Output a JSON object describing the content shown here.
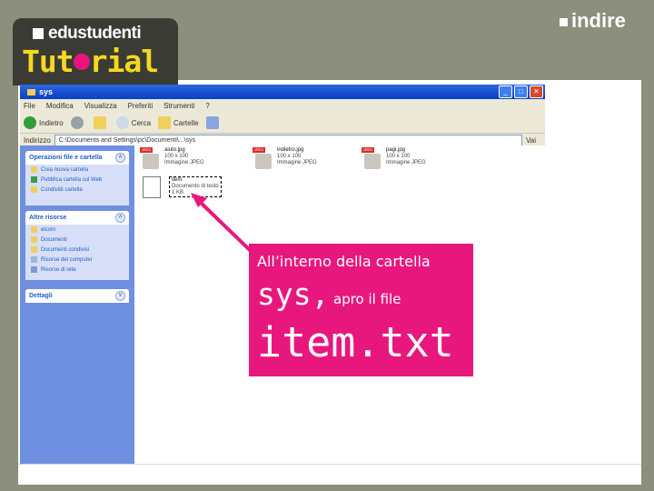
{
  "header": {
    "logo_name": "edustudenti",
    "logo_tutorial_part1": "Tut",
    "logo_tutorial_part2": "rial",
    "brand": "indire"
  },
  "window": {
    "title": "sys",
    "menu": [
      "File",
      "Modifica",
      "Visualizza",
      "Preferiti",
      "Strumenti",
      "?"
    ],
    "toolbar": {
      "back": "Indietro",
      "search": "Cerca",
      "folders": "Cartelle"
    },
    "address_label": "Indirizzo",
    "address_value": "C:\\Documents and Settings\\pc\\Documenti\\...\\sys",
    "go_label": "Vai"
  },
  "sidebar": {
    "panel1": {
      "title": "Operazioni file e cartella",
      "items": [
        "Crea nuova cartella",
        "Pubblica cartella sul Web",
        "Condividi cartella"
      ]
    },
    "panel2": {
      "title": "Altre risorse",
      "items": [
        "elcom",
        "Documenti",
        "Documenti condivisi",
        "Risorse del computer",
        "Risorse di rete"
      ]
    },
    "panel3": {
      "title": "Dettagli"
    }
  },
  "files": [
    {
      "name": "aiuto.jpg",
      "line2": "100 x 100",
      "line3": "Immagine JPEG"
    },
    {
      "name": "indietro.jpg",
      "line2": "100 x 100",
      "line3": "Immagine JPEG"
    },
    {
      "name": "pagi.jpg",
      "line2": "100 x 100",
      "line3": "Immagine JPEG"
    },
    {
      "name": "item",
      "line2": "Documento di testo",
      "line3": "1 KB"
    }
  ],
  "callout": {
    "line1": "All’interno della cartella",
    "sys": "sys,",
    "apro": "apro il file",
    "item": "item.txt"
  },
  "colors": {
    "accent": "#e8177e",
    "tutorial_yellow": "#f6d81d",
    "xp_blue": "#0a3fc3"
  }
}
